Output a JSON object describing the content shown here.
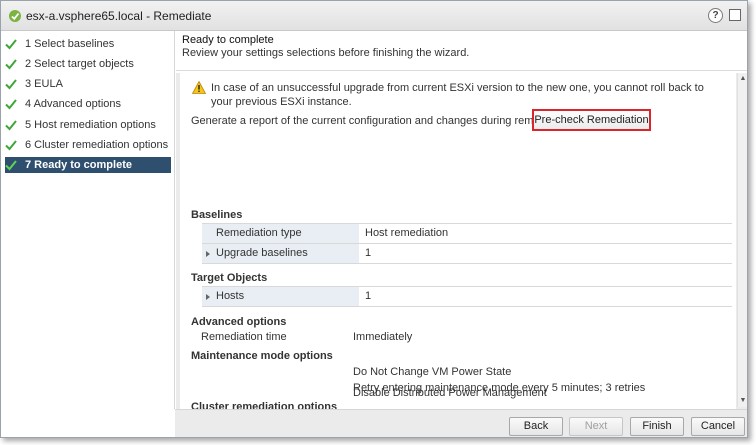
{
  "window": {
    "title": "esx-a.vsphere65.local - Remediate",
    "help_label": "?"
  },
  "steps": [
    {
      "label": "1  Select baselines",
      "done": true
    },
    {
      "label": "2  Select target objects",
      "done": true
    },
    {
      "label": "3  EULA",
      "done": true
    },
    {
      "label": "4  Advanced options",
      "done": true
    },
    {
      "label": "5  Host remediation options",
      "done": true
    },
    {
      "label": "6  Cluster remediation options",
      "done": true
    },
    {
      "label": "7  Ready to complete",
      "done": true,
      "active": true
    }
  ],
  "header": {
    "title": "Ready to complete",
    "subtitle": "Review your settings selections before finishing the wizard."
  },
  "warning": {
    "text": "In case of an unsuccessful upgrade from current ESXi version to the new one, you cannot roll back to your previous ESXi instance.",
    "icon": "warning-icon"
  },
  "report": {
    "text": "Generate a report of the current configuration and changes during remediation:",
    "button_label": "Pre-check Remediation"
  },
  "baselines": {
    "title": "Baselines",
    "rows": [
      {
        "key": "Remediation type",
        "value": "Host remediation",
        "expandable": false
      },
      {
        "key": "Upgrade baselines",
        "value": "1",
        "expandable": true
      }
    ]
  },
  "target_objects": {
    "title": "Target Objects",
    "rows": [
      {
        "key": "Hosts",
        "value": "1",
        "expandable": true
      }
    ]
  },
  "advanced": {
    "title": "Advanced options",
    "key": "Remediation time",
    "value": "Immediately"
  },
  "maintenance": {
    "title": "Maintenance mode options",
    "values": [
      "Do Not Change VM Power State",
      "Retry entering maintenance mode every 5 minutes; 3 retries"
    ]
  },
  "cluster": {
    "title": "Cluster remediation options",
    "values": [
      "Disable Distributed Power Management"
    ]
  },
  "footer": {
    "back": "Back",
    "next": "Next",
    "finish": "Finish",
    "cancel": "Cancel"
  },
  "colors": {
    "active_step": "#2f4f6f",
    "check": "#3fa63a",
    "highlight_border": "#d9262b",
    "grid_key_bg": "#e8eef4"
  }
}
